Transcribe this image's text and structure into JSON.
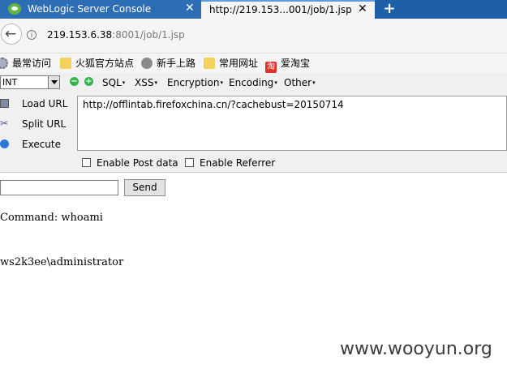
{
  "tabs": [
    {
      "title": "WebLogic Server Console",
      "close": "✕"
    },
    {
      "title": "http://219.153...001/job/1.jsp",
      "close": "✕"
    }
  ],
  "new_tab_label": "+",
  "nav": {
    "back_glyph": "←",
    "info_glyph": "i",
    "url_host": "219.153.6.38",
    "url_rest": ":8001/job/1.jsp"
  },
  "bookmarks": [
    {
      "label": "最常访问",
      "icon": "gear-icon"
    },
    {
      "label": "火狐官方站点",
      "icon": "folder-icon"
    },
    {
      "label": "新手上路",
      "icon": "globe-icon"
    },
    {
      "label": "常用网址",
      "icon": "folder-icon"
    },
    {
      "label": "爱淘宝",
      "icon": "taobao-icon",
      "icon_text": "淘"
    }
  ],
  "hackbar": {
    "select_value": "INT",
    "minus": "−",
    "plus": "+",
    "menus": [
      "SQL",
      "XSS",
      "Encryption",
      "Encoding",
      "Other"
    ],
    "caret": "▾",
    "actions": [
      {
        "label": "Load URL",
        "icon": "disk-icon"
      },
      {
        "label": "Split URL",
        "icon": "scissors-icon"
      },
      {
        "label": "Execute",
        "icon": "play-icon"
      }
    ],
    "url_value": "http://offlintab.firefoxchina.cn/?cachebust=20150714",
    "enable_post": "Enable Post data",
    "enable_referrer": "Enable Referrer"
  },
  "page": {
    "input_value": "",
    "send_label": "Send",
    "command_line": "Command: whoami",
    "result_line": "ws2k3ee\\administrator"
  },
  "watermark": "www.wooyun.org",
  "colors": {
    "tabstrip": "#1d5fa8",
    "active_tab_accent": "#5b9de0",
    "hackbar_green": "#37b24d"
  }
}
